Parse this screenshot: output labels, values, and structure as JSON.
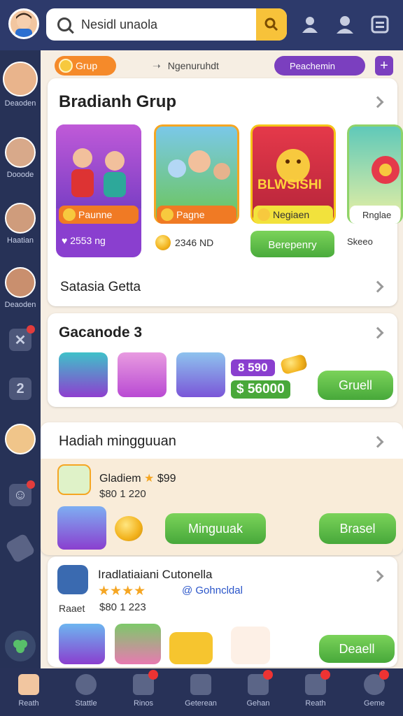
{
  "search": {
    "text": "Nesidl unaola"
  },
  "rail": {
    "items": [
      {
        "label": "Deaoden"
      },
      {
        "label": "Dooode"
      },
      {
        "label": "Haatian"
      },
      {
        "label": "Deaoden"
      }
    ],
    "numeric_label": "2"
  },
  "filters": {
    "grup": "Grup",
    "mid": "Ngenuruhdt",
    "premium": "Peachemin",
    "plus": "+"
  },
  "section1": {
    "title": "Bradianh Grup",
    "tiles": [
      {
        "label": "Paunne",
        "sub": "2553 ng"
      },
      {
        "label": "Pagne",
        "sub": "2346 ND"
      },
      {
        "label": "Negiaen",
        "sub": "Berepenry",
        "art_text": "BLWSISHI"
      },
      {
        "label": "Rnglae",
        "sub": "Skeeo"
      }
    ],
    "row_label": "Satasia Getta"
  },
  "section2": {
    "title": "Gacanode 3",
    "value1": "8 590",
    "value2": "$ 56000",
    "button": "Gruell"
  },
  "section3": {
    "title": "Hadiah mingguuan",
    "entry_name": "Gladiem",
    "entry_num": "$99",
    "entry_sub": "$80 1 220",
    "button_left": "Minguuak",
    "button_right": "Brasel"
  },
  "section4": {
    "title": "Iradlatiaiani Cutonella",
    "link": "@ Gohncldal",
    "meta_left": "Raaet",
    "meta_mid": "$80 1 223",
    "button": "Deaell"
  },
  "bottom_nav": [
    {
      "label": "Reath"
    },
    {
      "label": "Stattle"
    },
    {
      "label": "Rinos"
    },
    {
      "label": "Geterean"
    },
    {
      "label": "Gehan"
    },
    {
      "label": "Reath"
    },
    {
      "label": "Geme"
    }
  ],
  "colors": {
    "topbar": "#2d3a6b",
    "accent_orange": "#f58a2a",
    "accent_purple": "#7b3fbf",
    "accent_green": "#47a83a",
    "gold": "#f7c93e"
  }
}
